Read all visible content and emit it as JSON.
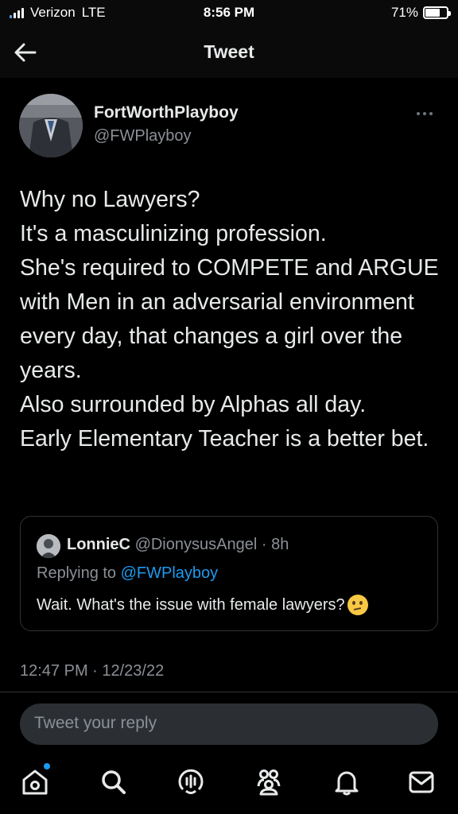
{
  "status_bar": {
    "carrier": "Verizon",
    "network": "LTE",
    "time": "8:56 PM",
    "battery_text": "71%",
    "battery_level": 0.71
  },
  "header": {
    "title": "Tweet",
    "back_icon": "arrow-left-icon"
  },
  "tweet": {
    "author_name": "FortWorthPlayboy",
    "author_handle": "@FWPlayboy",
    "text": "Why no Lawyers?\nIt's a masculinizing profession.\nShe's required to COMPETE and ARGUE with Men in an adversarial environment every day, that changes a girl over the years.\nAlso surrounded by Alphas all day.\nEarly Elementary Teacher is a better bet.",
    "timestamp": "12:47 PM · 12/23/22"
  },
  "quoted_tweet": {
    "author_name": "LonnieC",
    "author_handle": "@DionysusAngel",
    "separator": "·",
    "time": "8h",
    "replying_prefix": "Replying to",
    "replying_to": "@FWPlayboy",
    "text": "Wait. What's the issue with female lawyers?",
    "emoji": "thinking-face"
  },
  "reply": {
    "placeholder": "Tweet your reply"
  },
  "nav": {
    "items": [
      "home-icon",
      "search-icon",
      "spaces-icon",
      "communities-icon",
      "notifications-icon",
      "messages-icon"
    ]
  },
  "colors": {
    "background": "#000000",
    "text": "#e7e9ea",
    "secondary": "#8b9096",
    "accent": "#1d9bf0"
  }
}
